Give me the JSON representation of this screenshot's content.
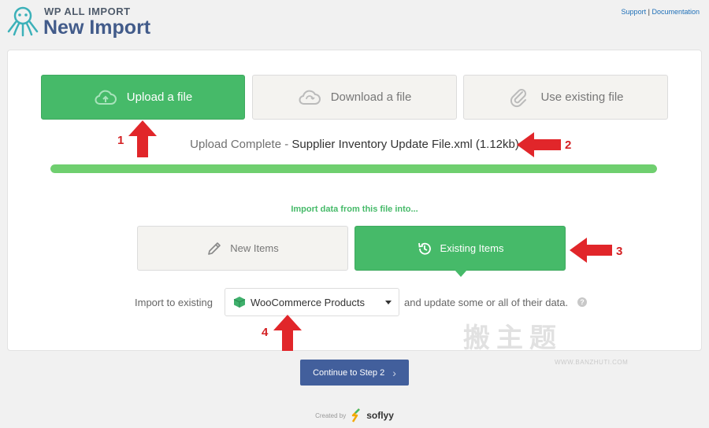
{
  "header": {
    "brand_small": "WP ALL IMPORT",
    "title": "New Import",
    "links": {
      "support": "Support",
      "separator": "|",
      "documentation": "Documentation"
    }
  },
  "tabs": [
    {
      "label": "Upload a file",
      "icon": "cloud-upload-icon",
      "active": true
    },
    {
      "label": "Download a file",
      "icon": "cloud-sync-icon",
      "active": false
    },
    {
      "label": "Use existing file",
      "icon": "paperclip-icon",
      "active": false
    }
  ],
  "upload_status": {
    "prefix": "Upload Complete",
    "dash": " - ",
    "filename": "Supplier Inventory Update File.xml (1.12kb)",
    "progress": 1.0
  },
  "import_into_label": "Import data from this file into...",
  "choices": [
    {
      "label": "New Items",
      "icon": "pencil-icon",
      "active": false
    },
    {
      "label": "Existing Items",
      "icon": "history-icon",
      "active": true
    }
  ],
  "import_row": {
    "label": "Import to existing",
    "selected": "WooCommerce Products",
    "after": "and update some or all of their data.",
    "help": "?"
  },
  "continue_button": {
    "label": "Continue to Step 2",
    "chevron": "›"
  },
  "footer": {
    "created_by": "Created by",
    "brand": "soflyy"
  },
  "annotations": [
    "1",
    "2",
    "3",
    "4"
  ],
  "watermark": {
    "text": "搬主题",
    "url": "WWW.BANZHUTI.COM"
  },
  "colors": {
    "accent_green": "#46ba69",
    "title_blue": "#425b8a",
    "button_blue": "#425f9c",
    "arrow_red": "#d42124",
    "progress": "#6fcf6f"
  }
}
